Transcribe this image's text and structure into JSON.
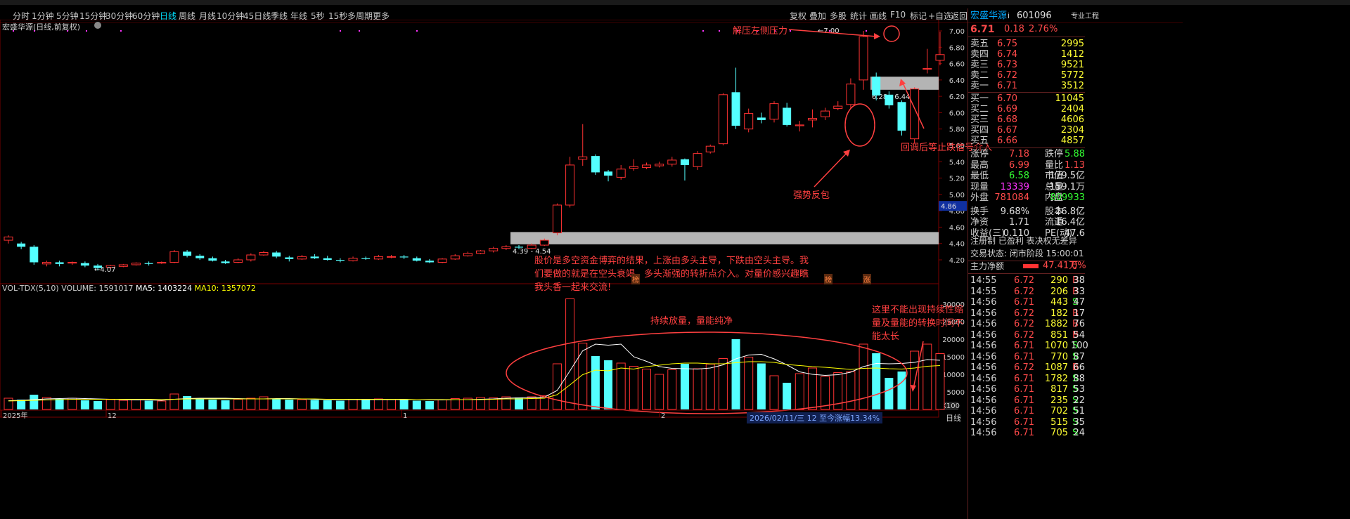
{
  "periods": [
    "分时",
    "1分钟",
    "5分钟",
    "15分钟",
    "30分钟",
    "60分钟",
    "日线",
    "周线",
    "月线",
    "10分钟",
    "45日线",
    "季线",
    "年线",
    "5秒",
    "15秒",
    "多周期",
    "更多"
  ],
  "period_active": "日线",
  "tools": [
    "复权",
    "叠加",
    "多股",
    "统计",
    "画线",
    "F10",
    "标记",
    "+自选",
    "返回"
  ],
  "chart_title": "宏盛华源(日线,前复权)",
  "price_axis": [
    "7.00",
    "6.80",
    "6.60",
    "6.40",
    "6.20",
    "6.00",
    "5.80",
    "5.60",
    "5.40",
    "5.20",
    "5.00",
    "4.80",
    "4.60",
    "4.40",
    "4.20"
  ],
  "current_price_tag": "4.86",
  "high_label": "7.00",
  "low_label": "4.07",
  "zone_upper_label": "6.28 - 6.44",
  "zone_lower_label": "4.39 - 4.54",
  "ann_top": "解压左侧压力",
  "ann_right": "回调后等止跌信号介入",
  "ann_mid": "强势反包",
  "ann_body": "股价是多空资金博弈的结果，上涨由多头主导，下跌由空头主导。我们要做的就是在空头衰竭、多头渐强的转折点介入。对量价感兴趣瞧我头香一起来交流!",
  "ann_volume": "持续放量，量能纯净",
  "ann_right_volume": "这里不能出现持续性缩量及量能的转换时间不能太长",
  "marker_1": "榜",
  "marker_2": "榜",
  "marker_3": "涨",
  "vol_name": "VOL-TDX(5,10)",
  "vol_value": "VOLUME: 1591017",
  "ma5": "MA5: 1403224",
  "ma10": "MA10: 1357072",
  "vol_axis": [
    "30000",
    "25000",
    "20000",
    "15000",
    "10000",
    "5000"
  ],
  "vol_unit": "X100",
  "x_labels": [
    "2025年",
    "12",
    "1",
    "2"
  ],
  "status_bar": "2026/02/11/三  12 至今涨幅13.34%",
  "period_label": "日线",
  "stock": {
    "name": "宏盛华源",
    "code": "601096",
    "badge": "专业工程",
    "price": "6.71",
    "change": "0.18",
    "pct": "2.76%"
  },
  "sell": [
    {
      "label": "卖五",
      "price": "6.75",
      "vol": "2995"
    },
    {
      "label": "卖四",
      "price": "6.74",
      "vol": "1412"
    },
    {
      "label": "卖三",
      "price": "6.73",
      "vol": "9521"
    },
    {
      "label": "卖二",
      "price": "6.72",
      "vol": "5772"
    },
    {
      "label": "卖一",
      "price": "6.71",
      "vol": "3512"
    }
  ],
  "buy": [
    {
      "label": "买一",
      "price": "6.70",
      "vol": "11045"
    },
    {
      "label": "买二",
      "price": "6.69",
      "vol": "2404"
    },
    {
      "label": "买三",
      "price": "6.68",
      "vol": "4606"
    },
    {
      "label": "买四",
      "price": "6.67",
      "vol": "2304"
    },
    {
      "label": "买五",
      "price": "6.66",
      "vol": "4857"
    }
  ],
  "stats": [
    [
      "涨停",
      "7.18",
      "跌停",
      "5.88"
    ],
    [
      "最高",
      "6.99",
      "量比",
      "1.13"
    ],
    [
      "最低",
      "6.58",
      "市值",
      "179.5亿"
    ],
    [
      "现量",
      "13339",
      "总量",
      "159.1万"
    ],
    [
      "外盘",
      "781084",
      "内盘",
      "809933"
    ]
  ],
  "stats2": [
    [
      "换手",
      "9.68%",
      "股本",
      "26.8亿"
    ],
    [
      "净资",
      "1.71",
      "流通",
      "16.4亿"
    ],
    [
      "收益(三)",
      "0.110",
      "PE(动)",
      "47.6"
    ]
  ],
  "reg": "注册制 已盈利 表决权无差异",
  "trade_status": "交易状态: 闭市阶段 15:00:01",
  "net_flow_label": "主力净额",
  "net_flow_value": "47.41万",
  "net_flow_pct": "0%",
  "ticks": [
    [
      "14:55",
      "6.72",
      "290",
      "B",
      "38"
    ],
    [
      "14:55",
      "6.72",
      "206",
      "B",
      "33"
    ],
    [
      "14:56",
      "6.71",
      "443",
      "S",
      "47"
    ],
    [
      "14:56",
      "6.72",
      "182",
      "B",
      "17"
    ],
    [
      "14:56",
      "6.72",
      "1882",
      "B",
      "76"
    ],
    [
      "14:56",
      "6.72",
      "851",
      "B",
      "54"
    ],
    [
      "14:56",
      "6.71",
      "1070",
      "S",
      "100"
    ],
    [
      "14:56",
      "6.71",
      "770",
      "S",
      "87"
    ],
    [
      "14:56",
      "6.72",
      "1087",
      "B",
      "66"
    ],
    [
      "14:56",
      "6.71",
      "1782",
      "S",
      "88"
    ],
    [
      "14:56",
      "6.71",
      "817",
      "S",
      "53"
    ],
    [
      "14:56",
      "6.71",
      "235",
      "S",
      "22"
    ],
    [
      "14:56",
      "6.71",
      "702",
      "S",
      "51"
    ],
    [
      "14:56",
      "6.71",
      "515",
      "S",
      "35"
    ],
    [
      "14:56",
      "6.71",
      "705",
      "S",
      "24"
    ]
  ],
  "colors": {
    "up": "#ff3232",
    "down": "#54ffff",
    "ma5": "#ffffff",
    "ma10": "#ffff00",
    "annotation": "#ff4040"
  },
  "chart_data": {
    "type": "candlestick",
    "yrange": [
      4.0,
      7.15
    ],
    "candles": [
      [
        4.44,
        4.48,
        4.4,
        4.5
      ],
      [
        4.4,
        4.36,
        4.33,
        4.42
      ],
      [
        4.36,
        4.17,
        4.14,
        4.38
      ],
      [
        4.15,
        4.17,
        4.12,
        4.19
      ],
      [
        4.17,
        4.15,
        4.12,
        4.19
      ],
      [
        4.16,
        4.17,
        4.14,
        4.18
      ],
      [
        4.16,
        4.13,
        4.11,
        4.18
      ],
      [
        4.13,
        4.1,
        4.07,
        4.15
      ],
      [
        4.11,
        4.13,
        4.09,
        4.14
      ],
      [
        4.12,
        4.14,
        4.11,
        4.15
      ],
      [
        4.14,
        4.16,
        4.13,
        4.17
      ],
      [
        4.16,
        4.15,
        4.13,
        4.18
      ],
      [
        4.16,
        4.17,
        4.15,
        4.18
      ],
      [
        4.17,
        4.3,
        4.16,
        4.32
      ],
      [
        4.3,
        4.25,
        4.23,
        4.32
      ],
      [
        4.25,
        4.22,
        4.2,
        4.27
      ],
      [
        4.22,
        4.19,
        4.18,
        4.24
      ],
      [
        4.18,
        4.16,
        4.15,
        4.2
      ],
      [
        4.17,
        4.2,
        4.16,
        4.22
      ],
      [
        4.2,
        4.26,
        4.18,
        4.28
      ],
      [
        4.26,
        4.29,
        4.25,
        4.31
      ],
      [
        4.29,
        4.24,
        4.22,
        4.31
      ],
      [
        4.23,
        4.21,
        4.18,
        4.25
      ],
      [
        4.21,
        4.24,
        4.2,
        4.26
      ],
      [
        4.24,
        4.22,
        4.21,
        4.27
      ],
      [
        4.22,
        4.2,
        4.19,
        4.25
      ],
      [
        4.2,
        4.19,
        4.17,
        4.22
      ],
      [
        4.19,
        4.22,
        4.18,
        4.24
      ],
      [
        4.22,
        4.21,
        4.2,
        4.24
      ],
      [
        4.21,
        4.24,
        4.2,
        4.26
      ],
      [
        4.24,
        4.24,
        4.22,
        4.26
      ],
      [
        4.24,
        4.23,
        4.21,
        4.26
      ],
      [
        4.22,
        4.19,
        4.18,
        4.24
      ],
      [
        4.19,
        4.17,
        4.16,
        4.21
      ],
      [
        4.17,
        4.21,
        4.16,
        4.22
      ],
      [
        4.21,
        4.25,
        4.2,
        4.27
      ],
      [
        4.25,
        4.28,
        4.24,
        4.3
      ],
      [
        4.28,
        4.31,
        4.27,
        4.32
      ],
      [
        4.31,
        4.34,
        4.29,
        4.36
      ],
      [
        4.34,
        4.36,
        4.32,
        4.38
      ],
      [
        4.36,
        4.35,
        4.33,
        4.38
      ],
      [
        4.34,
        4.38,
        4.33,
        4.4
      ],
      [
        4.38,
        4.44,
        4.37,
        4.46
      ],
      [
        4.53,
        4.87,
        4.5,
        4.89
      ],
      [
        4.87,
        5.36,
        4.84,
        5.46
      ],
      [
        5.43,
        5.46,
        5.35,
        5.86
      ],
      [
        5.47,
        5.27,
        5.24,
        5.49
      ],
      [
        5.28,
        5.23,
        5.16,
        5.3
      ],
      [
        5.21,
        5.31,
        5.18,
        5.36
      ],
      [
        5.32,
        5.34,
        5.29,
        5.43
      ],
      [
        5.33,
        5.36,
        5.31,
        5.39
      ],
      [
        5.35,
        5.37,
        5.33,
        5.4
      ],
      [
        5.37,
        5.42,
        5.34,
        5.46
      ],
      [
        5.43,
        5.36,
        5.17,
        5.44
      ],
      [
        5.34,
        5.5,
        5.3,
        5.53
      ],
      [
        5.52,
        5.59,
        5.5,
        5.61
      ],
      [
        5.62,
        6.22,
        5.6,
        6.24
      ],
      [
        6.25,
        5.84,
        5.8,
        6.55
      ],
      [
        5.8,
        5.99,
        5.76,
        6.05
      ],
      [
        5.94,
        5.91,
        5.87,
        6.0
      ],
      [
        5.92,
        6.11,
        5.88,
        6.14
      ],
      [
        6.06,
        5.85,
        5.83,
        6.12
      ],
      [
        5.84,
        5.85,
        5.77,
        5.9
      ],
      [
        5.91,
        5.93,
        5.82,
        6.04
      ],
      [
        5.95,
        6.02,
        5.91,
        6.06
      ],
      [
        6.05,
        6.08,
        6.03,
        6.14
      ],
      [
        6.1,
        6.35,
        6.05,
        6.42
      ],
      [
        6.4,
        6.93,
        6.28,
        7.0
      ],
      [
        6.44,
        6.21,
        6.15,
        6.49
      ],
      [
        6.22,
        6.09,
        6.05,
        6.26
      ],
      [
        6.13,
        5.78,
        5.72,
        6.15
      ],
      [
        5.68,
        6.29,
        5.62,
        6.31
      ],
      [
        6.54,
        6.54,
        6.48,
        6.78
      ],
      [
        6.64,
        6.71,
        6.58,
        6.99
      ]
    ],
    "volume_range": [
      0,
      32000
    ],
    "volumes": [
      3200,
      2800,
      4200,
      3400,
      3000,
      3200,
      2600,
      2400,
      2800,
      2600,
      2700,
      2500,
      2400,
      4400,
      3800,
      3100,
      2800,
      2600,
      2900,
      3200,
      3600,
      3100,
      2800,
      2800,
      2700,
      2600,
      2500,
      2900,
      2800,
      3000,
      2900,
      2700,
      2500,
      2400,
      2800,
      3100,
      3200,
      3400,
      3300,
      3600,
      3400,
      3600,
      3900,
      13000,
      31500,
      18900,
      15200,
      14000,
      13200,
      12300,
      11500,
      10000,
      11300,
      13000,
      11600,
      12900,
      14500,
      20000,
      14900,
      13100,
      9600,
      7600,
      10200,
      11800,
      9400,
      10500,
      10800,
      18600,
      16000,
      9000,
      10800,
      16600,
      18600,
      15900
    ],
    "ma5": [
      2500,
      2600,
      2800,
      3000,
      3100,
      3200,
      3100,
      3000,
      2900,
      2800,
      2700,
      2700,
      2600,
      2900,
      3100,
      3200,
      3200,
      3200,
      3100,
      3000,
      3000,
      3100,
      3100,
      3000,
      2900,
      2800,
      2800,
      2800,
      2800,
      2800,
      2800,
      2800,
      2800,
      2700,
      2700,
      2800,
      2800,
      2900,
      3000,
      3200,
      3300,
      3400,
      3500,
      5400,
      11000,
      16700,
      18600,
      18300,
      18600,
      15000,
      13700,
      12200,
      11700,
      11600,
      11500,
      11800,
      12700,
      14400,
      15500,
      15700,
      14400,
      12700,
      10700,
      10000,
      9700,
      9900,
      10600,
      12200,
      13100,
      13000,
      13100,
      13400,
      14200,
      14000
    ],
    "ma10": [
      2400,
      2500,
      2600,
      2700,
      2800,
      2900,
      2900,
      2900,
      2900,
      2900,
      2900,
      2900,
      2800,
      2900,
      3000,
      3000,
      3000,
      3000,
      3000,
      3000,
      3000,
      3000,
      3000,
      3000,
      3000,
      2900,
      2900,
      2900,
      2900,
      2900,
      2900,
      2900,
      2800,
      2800,
      2800,
      2800,
      2800,
      2800,
      2900,
      3000,
      3000,
      3100,
      3200,
      4200,
      7000,
      9900,
      11200,
      11000,
      11800,
      11500,
      12200,
      12600,
      13000,
      13200,
      13200,
      13000,
      13000,
      13300,
      13600,
      13600,
      13400,
      12800,
      12500,
      12200,
      12000,
      11700,
      11400,
      11700,
      11800,
      11600,
      11500,
      11800,
      12300,
      12500
    ]
  }
}
